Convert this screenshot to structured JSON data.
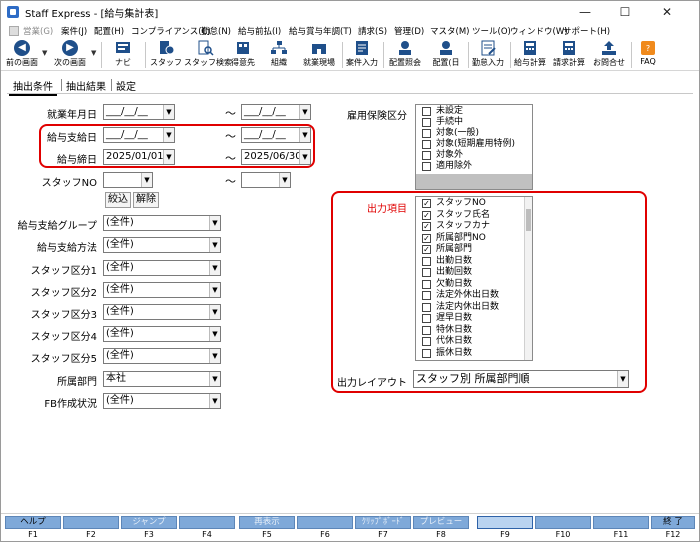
{
  "window": {
    "title": "Staff Express - [給与集計表]",
    "minimize": "—",
    "maximize": "☐",
    "close": "✕"
  },
  "menu": [
    "営業(G)",
    "案件(J)",
    "配置(H)",
    "コンプライアンス(C)",
    "勤怠(N)",
    "給与前払(I)",
    "給与賞与年調(T)",
    "請求(S)",
    "管理(D)",
    "マスタ(M)",
    "ツール(O)",
    "ウィンドウ(W)",
    "サポート(H)"
  ],
  "toolbar": {
    "prev": "前の画面",
    "next": "次の画面",
    "navi": "ナビ",
    "staff": "スタッフ",
    "staff_search": "スタッフ検索",
    "client": "得意先",
    "org": "組織",
    "site": "就業現場",
    "case_input": "案件入力",
    "assign_inquiry": "配置照会",
    "assign_day": "配置(日",
    "attendance_input": "勤怠入力",
    "salary_calc": "給与計算",
    "billing_calc": "請求計算",
    "inquiry": "お問合せ",
    "faq": "FAQ"
  },
  "tabs": [
    "抽出条件",
    "抽出結果",
    "設定"
  ],
  "form": {
    "employment_ym_label": "就業年月日",
    "pay_date_label": "給与支給日",
    "close_date_label": "給与締日",
    "close_date_from": "2025/01/01",
    "close_date_to": "2025/06/30",
    "date_blank": "___/__/__",
    "staff_no_label": "スタッフNO",
    "tilde": "～",
    "filter_button": "絞込",
    "clear_button": "解除",
    "salary_group_label": "給与支給グループ",
    "payment_method_label": "給与支給方法",
    "staff_kbn1_label": "スタッフ区分1",
    "staff_kbn2_label": "スタッフ区分2",
    "staff_kbn3_label": "スタッフ区分3",
    "staff_kbn4_label": "スタッフ区分4",
    "staff_kbn5_label": "スタッフ区分5",
    "dept_label": "所属部門",
    "fb_label": "FB作成状況",
    "all_value": "(全件)",
    "dept_value": "本社"
  },
  "insurance": {
    "label": "雇用保険区分",
    "items": [
      {
        "text": "未設定",
        "checked": false
      },
      {
        "text": "手続中",
        "checked": false
      },
      {
        "text": "対象(一般)",
        "checked": false
      },
      {
        "text": "対象(短期雇用特例)",
        "checked": false
      },
      {
        "text": "対象外",
        "checked": false
      },
      {
        "text": "適用除外",
        "checked": false
      }
    ]
  },
  "output": {
    "label": "出力項目",
    "items": [
      {
        "text": "スタッフNO",
        "checked": true
      },
      {
        "text": "スタッフ氏名",
        "checked": true
      },
      {
        "text": "スタッフカナ",
        "checked": true
      },
      {
        "text": "所属部門NO",
        "checked": true
      },
      {
        "text": "所属部門",
        "checked": true
      },
      {
        "text": "出勤日数",
        "checked": false
      },
      {
        "text": "出勤回数",
        "checked": false
      },
      {
        "text": "欠勤日数",
        "checked": false
      },
      {
        "text": "法定外休出日数",
        "checked": false
      },
      {
        "text": "法定内休出日数",
        "checked": false
      },
      {
        "text": "遅早日数",
        "checked": false
      },
      {
        "text": "特休日数",
        "checked": false
      },
      {
        "text": "代休日数",
        "checked": false
      },
      {
        "text": "振休日数",
        "checked": false
      }
    ],
    "layout_label": "出力レイアウト",
    "layout_value": "スタッフ別 所属部門順"
  },
  "fkeys": [
    {
      "label": "ヘルプ",
      "key": "F1",
      "enabled": true
    },
    {
      "label": "",
      "key": "F2",
      "enabled": true
    },
    {
      "label": "ジャンプ",
      "key": "F3",
      "enabled": false
    },
    {
      "label": "",
      "key": "F4",
      "enabled": true
    },
    {
      "label": "再表示",
      "key": "F5",
      "enabled": false
    },
    {
      "label": "",
      "key": "F6",
      "enabled": true
    },
    {
      "label": "ｸﾘｯﾌﾟﾎﾞｰﾄﾞ",
      "key": "F7",
      "enabled": false
    },
    {
      "label": "プレビュー",
      "key": "F8",
      "enabled": false
    },
    {
      "label": "",
      "key": "F9",
      "enabled": true
    },
    {
      "label": "",
      "key": "F10",
      "enabled": true
    },
    {
      "label": "",
      "key": "F11",
      "enabled": true
    },
    {
      "label": "終 了",
      "key": "F12",
      "enabled": true
    }
  ],
  "colors": {
    "highlight": "#e00000",
    "fkey": "#7fa9d9",
    "selection": "#2d62c8",
    "toolbar_icon": "#1f4f8a"
  }
}
